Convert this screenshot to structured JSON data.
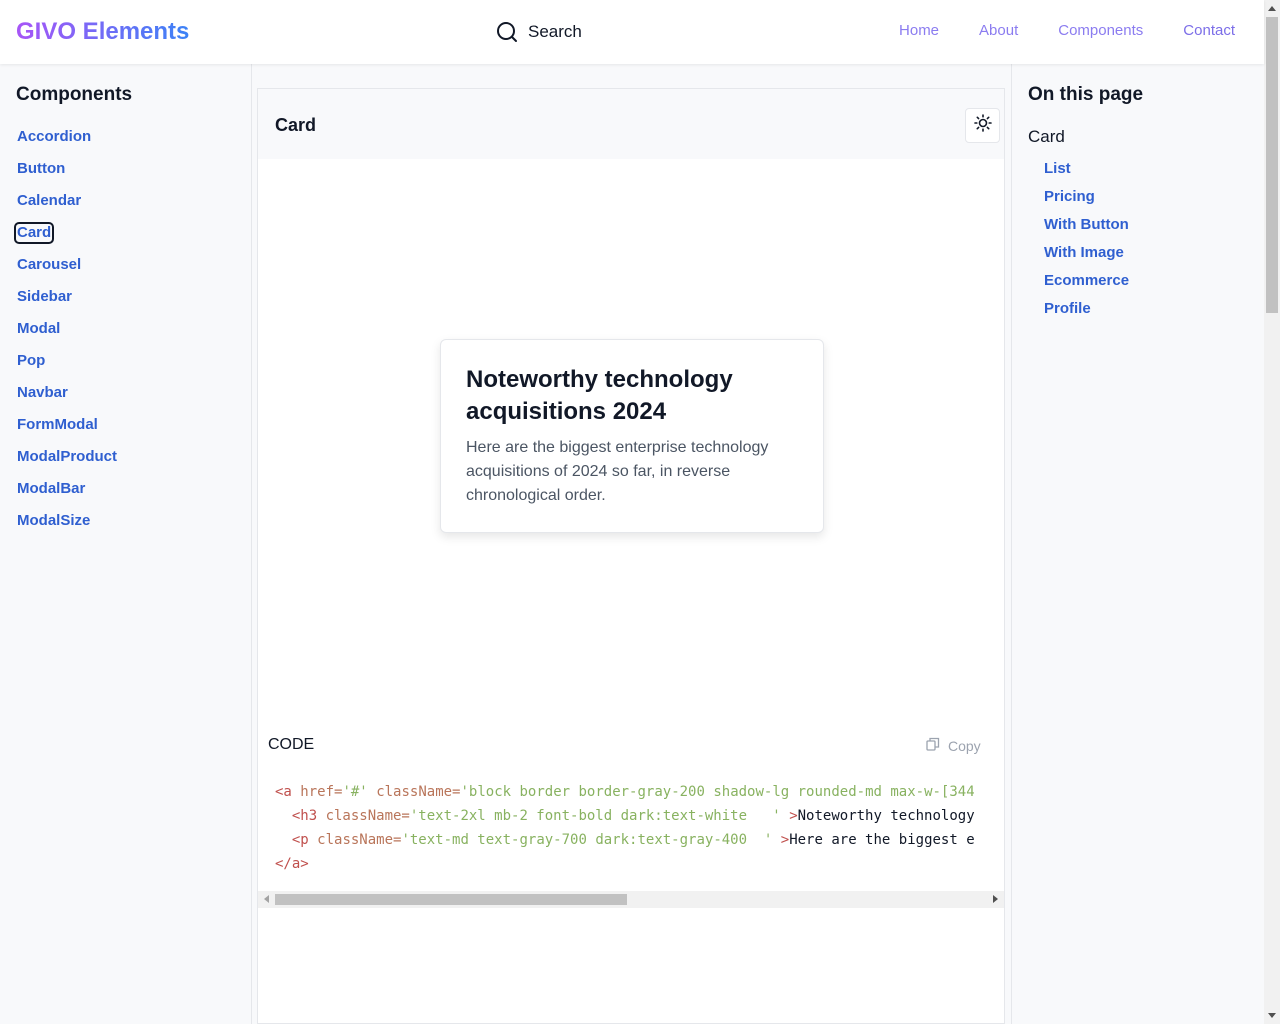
{
  "header": {
    "logo": "GIVO Elements",
    "search_label": "Search",
    "nav": [
      "Home",
      "About",
      "Components",
      "Contact"
    ]
  },
  "sidebar": {
    "title": "Components",
    "items": [
      "Accordion",
      "Button",
      "Calendar",
      "Card",
      "Carousel",
      "Sidebar",
      "Modal",
      "Pop",
      "Navbar",
      "FormModal",
      "ModalProduct",
      "ModalBar",
      "ModalSize"
    ],
    "active": "Card"
  },
  "main": {
    "title": "Card",
    "theme_icon": "sun-icon",
    "preview": {
      "heading": "Noteworthy technology acquisitions 2024",
      "body": "Here are the biggest enterprise technology acquisitions of 2024 so far, in reverse chronological order."
    },
    "code_label": "CODE",
    "copy_label": "Copy",
    "code_lines": [
      [
        {
          "t": "tag",
          "v": "<a "
        },
        {
          "t": "attr",
          "v": "href="
        },
        {
          "t": "str",
          "v": "'#'"
        },
        {
          "t": "plain",
          "v": " "
        },
        {
          "t": "attr",
          "v": "className="
        },
        {
          "t": "str",
          "v": "'block border border-gray-200 shadow-lg rounded-md max-w-[344"
        }
      ],
      [
        {
          "t": "plain",
          "v": "  "
        },
        {
          "t": "tag",
          "v": "<h3 "
        },
        {
          "t": "attr",
          "v": "className="
        },
        {
          "t": "str",
          "v": "'text-2xl mb-2 font-bold dark:text-white   '"
        },
        {
          "t": "plain",
          "v": " "
        },
        {
          "t": "tag",
          "v": ">"
        },
        {
          "t": "plain",
          "v": "Noteworthy technology"
        }
      ],
      [
        {
          "t": "plain",
          "v": "  "
        },
        {
          "t": "tag",
          "v": "<p "
        },
        {
          "t": "attr",
          "v": "className="
        },
        {
          "t": "str",
          "v": "'text-md text-gray-700 dark:text-gray-400  '"
        },
        {
          "t": "plain",
          "v": " "
        },
        {
          "t": "tag",
          "v": ">"
        },
        {
          "t": "plain",
          "v": "Here are the biggest e"
        }
      ],
      [
        {
          "t": "tag",
          "v": "</a>"
        }
      ]
    ]
  },
  "toc": {
    "title": "On this page",
    "root": "Card",
    "items": [
      "List",
      "Pricing",
      "With Button",
      "With Image",
      "Ecommerce",
      "Profile"
    ]
  },
  "colors": {
    "brand_gradient_start": "#a855f7",
    "brand_gradient_end": "#3b82f6",
    "nav_link": "#8b7cf0",
    "sidebar_link": "#2f5fd0"
  }
}
